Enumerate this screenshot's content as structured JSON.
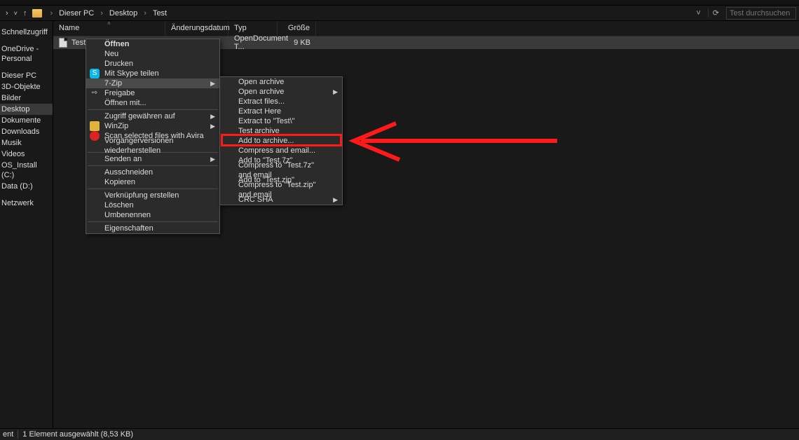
{
  "breadcrumb": {
    "root": "Dieser PC",
    "p1": "Desktop",
    "p2": "Test"
  },
  "search": {
    "placeholder": "Test durchsuchen"
  },
  "sidebar": {
    "quick": "Schnellzugriff",
    "onedrive": "OneDrive - Personal",
    "thispc": "Dieser PC",
    "objects3d": "3D-Objekte",
    "pictures": "Bilder",
    "desktop": "Desktop",
    "documents": "Dokumente",
    "downloads": "Downloads",
    "music": "Musik",
    "videos": "Videos",
    "osinstall": "OS_Install (C:)",
    "data": "Data (D:)",
    "network": "Netzwerk"
  },
  "columns": {
    "name": "Name",
    "date": "Änderungsdatum",
    "type": "Typ",
    "size": "Größe"
  },
  "file": {
    "name": "Test",
    "type": "OpenDocument T...",
    "size": "9 KB"
  },
  "menu1": {
    "open": "Öffnen",
    "new": "Neu",
    "print": "Drucken",
    "skype": "Mit Skype teilen",
    "sevenzip": "7-Zip",
    "share": "Freigabe",
    "openwith": "Öffnen mit...",
    "access": "Zugriff gewähren auf",
    "winzip": "WinZip",
    "avira": "Scan selected files with Avira",
    "prev": "Vorgängerversionen wiederherstellen",
    "sendto": "Senden an",
    "cut": "Ausschneiden",
    "copy": "Kopieren",
    "shortcut": "Verknüpfung erstellen",
    "delete": "Löschen",
    "rename": "Umbenennen",
    "props": "Eigenschaften"
  },
  "menu2": {
    "openarchive1": "Open archive",
    "openarchive2": "Open archive",
    "extractfiles": "Extract files...",
    "extracthere": "Extract Here",
    "extractto": "Extract to \"Test\\\"",
    "testarchive": "Test archive",
    "addtoarchive": "Add to archive...",
    "compressemail": "Compress and email...",
    "add7z": "Add to \"Test.7z\"",
    "compress7zemail": "Compress to \"Test.7z\" and email",
    "addzip": "Add to \"Test.zip\"",
    "compresszipemail": "Compress to \"Test.zip\" and email",
    "crcsha": "CRC SHA"
  },
  "status": {
    "count": "ent",
    "selected": "1 Element ausgewählt (8,53 KB)"
  }
}
